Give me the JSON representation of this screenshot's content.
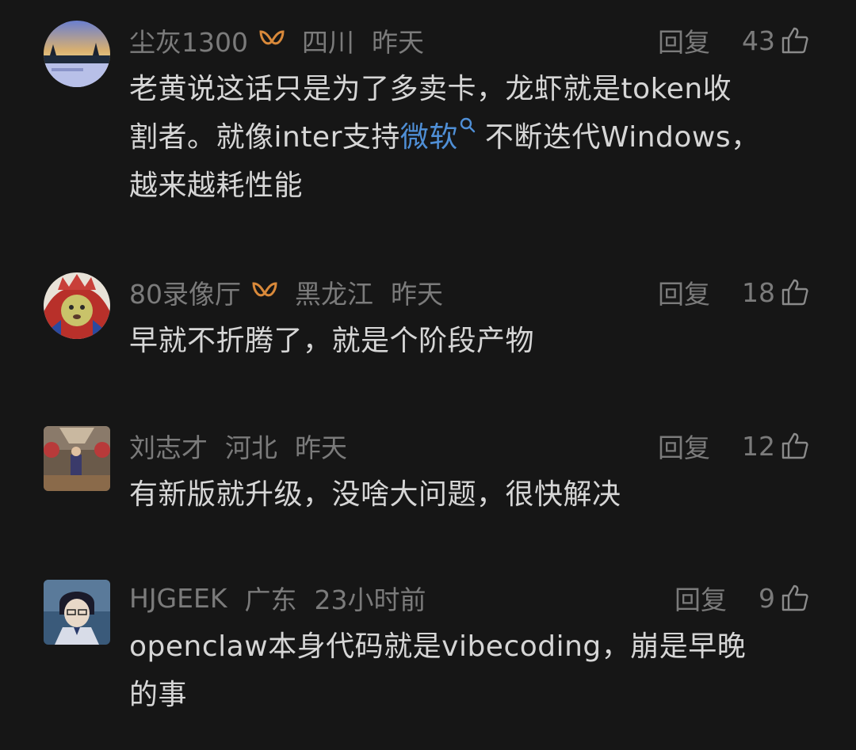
{
  "comments": [
    {
      "author": "尘灰1300",
      "region": "四川",
      "time": "昨天",
      "reply_label": "回复",
      "likes": "43",
      "has_badge": true,
      "text_lines": [
        "老黄说这话只是为了多卖卡，龙虾就是token收",
        "割者。就像inter支持",
        "微软",
        "不断迭代Windows，",
        "越来越耗性能"
      ]
    },
    {
      "author": "80录像厅",
      "region": "黑龙江",
      "time": "昨天",
      "reply_label": "回复",
      "likes": "18",
      "has_badge": true,
      "text": "早就不折腾了，就是个阶段产物"
    },
    {
      "author": "刘志才",
      "region": "河北",
      "time": "昨天",
      "reply_label": "回复",
      "likes": "12",
      "has_badge": false,
      "text": "有新版就升级，没啥大问题，很快解决"
    },
    {
      "author": "HJGEEK",
      "region": "广东",
      "time": "23小时前",
      "reply_label": "回复",
      "likes": "9",
      "has_badge": false,
      "text_lines": [
        "openclaw本身代码就是vibecoding，崩是早晚",
        "的事"
      ]
    }
  ],
  "colors": {
    "background": "#161616",
    "meta_text": "#7b7b7b",
    "body_text": "#d6d6d6",
    "link": "#4f8fd6",
    "badge": "#d9893a"
  },
  "icons": {
    "like": "thumbs-up-icon",
    "badge": "ribbon-badge-icon",
    "link_search": "search-icon"
  }
}
